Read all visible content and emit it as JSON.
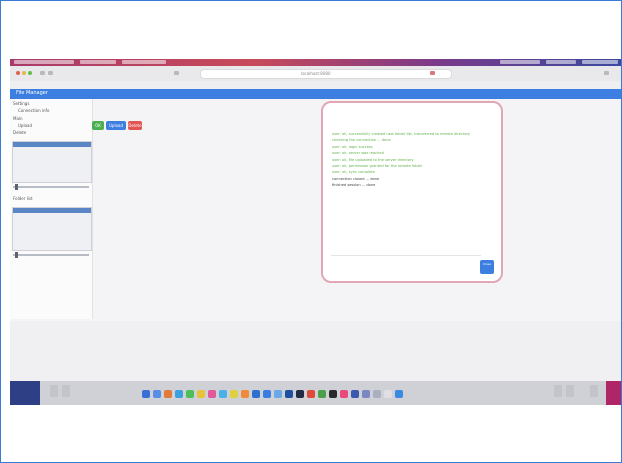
{
  "screen": {
    "app_title": "File Manager",
    "url": "localhost:8080",
    "sidebar": {
      "items": [
        "Settings",
        "Connection info",
        "Main",
        "Upload",
        "Delete",
        "Folder list"
      ]
    },
    "toolbar": {
      "buttons": [
        {
          "label": "OK",
          "color": "#4caf50"
        },
        {
          "label": "Upload",
          "color": "#3d7fe0"
        },
        {
          "label": "Delete",
          "color": "#e0554f"
        }
      ]
    },
    "dialog": {
      "log_lines": [
        {
          "text": "user: ok, successfully created new folder list, transferred to remote directory",
          "tone": "g"
        },
        {
          "text": "checking the connection ... done",
          "tone": "g"
        },
        {
          "text": "user: ok, login success",
          "tone": "g"
        },
        {
          "text": "user: ok, server was reached",
          "tone": "g"
        },
        {
          "text": "user: ok, file uploaded to the server directory",
          "tone": "g"
        },
        {
          "text": "user: ok, permission granted for the remote folder",
          "tone": "g"
        },
        {
          "text": "user: ok, sync complete",
          "tone": "g"
        },
        {
          "text": "connection closed ... done",
          "tone": "d"
        },
        {
          "text": "finished session ... done",
          "tone": "d"
        }
      ],
      "button_label": "Close"
    }
  },
  "colors": {
    "app_bar": "#3d7fe0",
    "dialog_border": "#e2a7b5",
    "log_green": "#5fb34a"
  }
}
